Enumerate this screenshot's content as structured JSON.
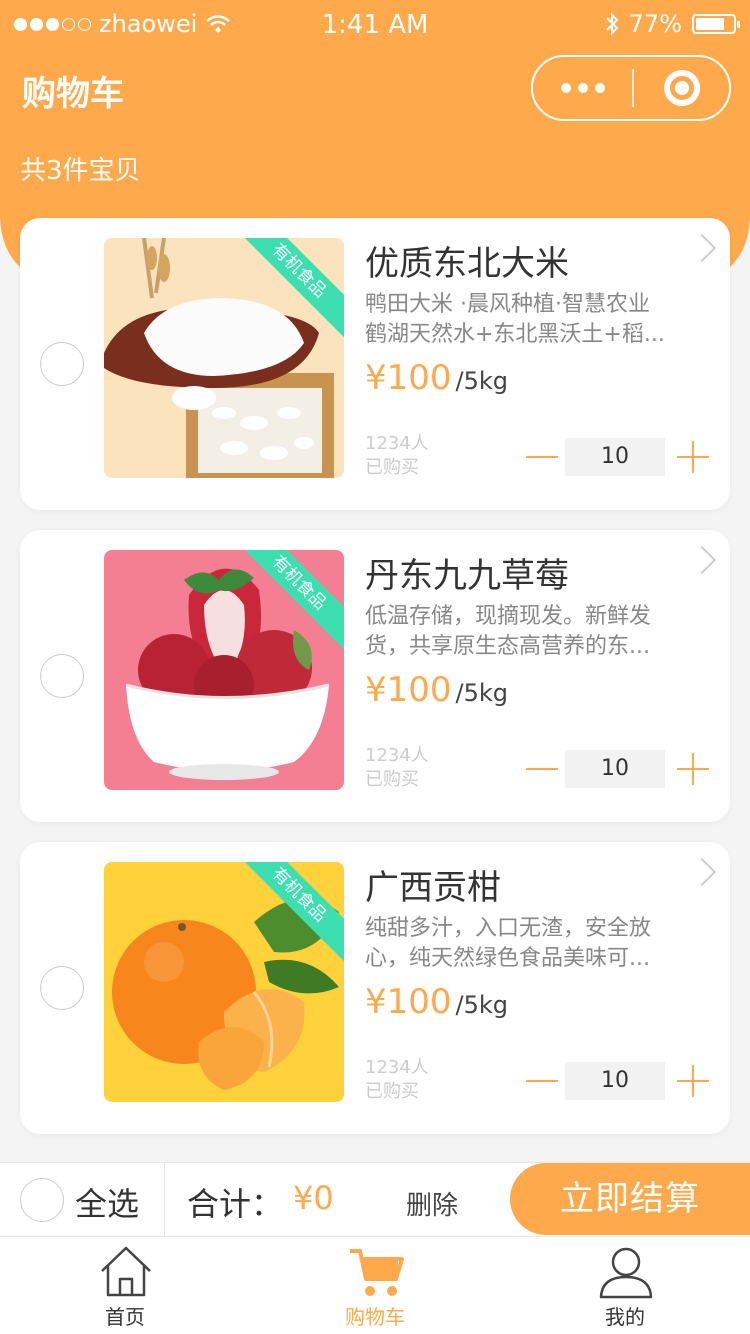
{
  "theme": {
    "accent": "#ffa94d",
    "ribbon": "#3ddfb0"
  },
  "status_bar": {
    "carrier": "zhaowei",
    "time": "1:41 AM",
    "battery": "77%",
    "battery_level": 0.77,
    "signal_dots": [
      true,
      true,
      true,
      false,
      false
    ]
  },
  "nav": {
    "title": "购物车"
  },
  "cart": {
    "count_text": "共3件宝贝"
  },
  "items": [
    {
      "name": "优质东北大米",
      "desc_line1": "鸭田大米 ·晨风种植·智慧农业",
      "desc_line2": "鹤湖天然水+东北黑沃土+稻...",
      "price": "¥100",
      "unit": "/5kg",
      "sold_count": "1234人",
      "sold_label": "已购买",
      "quantity": "10",
      "badge": "有机食品",
      "image": "rice-icon"
    },
    {
      "name": "丹东九九草莓",
      "desc_line1": "低温存储，现摘现发。新鲜发",
      "desc_line2": "货，共享原生态高营养的东...",
      "price": "¥100",
      "unit": "/5kg",
      "sold_count": "1234人",
      "sold_label": "已购买",
      "quantity": "10",
      "badge": "有机食品",
      "image": "strawberry-icon"
    },
    {
      "name": "广西贡柑",
      "desc_line1": "纯甜多汁，入口无渣，安全放",
      "desc_line2": "心，纯天然绿色食品美味可...",
      "price": "¥100",
      "unit": "/5kg",
      "sold_count": "1234人",
      "sold_label": "已购买",
      "quantity": "10",
      "badge": "有机食品",
      "image": "orange-icon"
    }
  ],
  "bottom_bar": {
    "select_all": "全选",
    "total_label": "合计：",
    "total_value": "¥0",
    "delete": "删除",
    "checkout": "立即结算"
  },
  "tabs": [
    {
      "label": "首页",
      "icon": "home-icon",
      "active": false
    },
    {
      "label": "购物车",
      "icon": "cart-icon",
      "active": true
    },
    {
      "label": "我的",
      "icon": "user-icon",
      "active": false
    }
  ]
}
